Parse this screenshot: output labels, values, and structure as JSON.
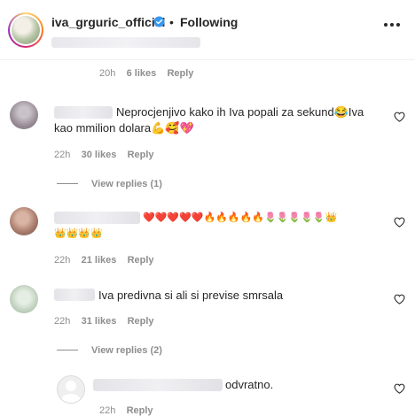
{
  "header": {
    "username": "iva_grguric_official",
    "dot": "•",
    "following_label": "Following"
  },
  "caption_meta": {
    "time": "20h",
    "likes": "6 likes",
    "reply": "Reply"
  },
  "comments": [
    {
      "text_line1": "Neprocjenjivo kako ih Iva popali za sekund😂Iva",
      "text_line2": "kao mmilion dolara💪🥰💖",
      "time": "22h",
      "likes": "30 likes",
      "reply": "Reply",
      "view_replies": "View replies (1)"
    },
    {
      "emoji_line1": "❤️❤️❤️❤️❤️🔥🔥🔥🔥🔥🌷🌷🌷🌷🌷👑",
      "emoji_line2": "👑👑👑👑",
      "time": "22h",
      "likes": "21 likes",
      "reply": "Reply"
    },
    {
      "text_line1": "Iva predivna si ali si previse smrsala",
      "time": "22h",
      "likes": "31 likes",
      "reply": "Reply",
      "view_replies": "View replies (2)"
    }
  ],
  "reply": {
    "text": "odvratno.",
    "time": "22h",
    "reply": "Reply"
  },
  "colors": {
    "text": "#262626",
    "muted": "#8e8e8e",
    "verified": "#3897f0"
  }
}
